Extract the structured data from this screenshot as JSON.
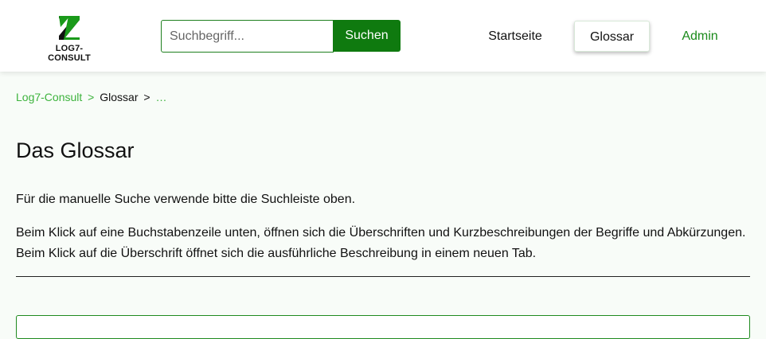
{
  "header": {
    "logo_text": "LOG7-CONSULT",
    "search": {
      "placeholder": "Suchbegriff...",
      "value": "",
      "button_label": "Suchen"
    },
    "nav": {
      "home": "Startseite",
      "glossary": "Glossar",
      "admin": "Admin"
    }
  },
  "breadcrumb": {
    "home": "Log7-Consult",
    "sep1": ">",
    "current": "Glossar",
    "sep2": ">",
    "ellipsis": "…"
  },
  "main": {
    "title": "Das Glossar",
    "paragraph1": "Für die manuelle Suche verwende bitte die Suchleiste oben.",
    "paragraph2_line1": "Beim Klick auf eine Buchstabenzeile unten, öffnen sich die Überschriften und Kurzbeschreibungen der Begriffe und Abkürzungen.",
    "paragraph2_line2": "Beim Klick auf die Überschrift öffnet sich die ausführliche Beschreibung in einem neuen Tab."
  },
  "colors": {
    "brand_green": "#0f7a0f",
    "link_green": "#3db33d",
    "page_background": "#f8fcf8"
  },
  "icons": {
    "logo": "log7-z-logo-icon"
  }
}
